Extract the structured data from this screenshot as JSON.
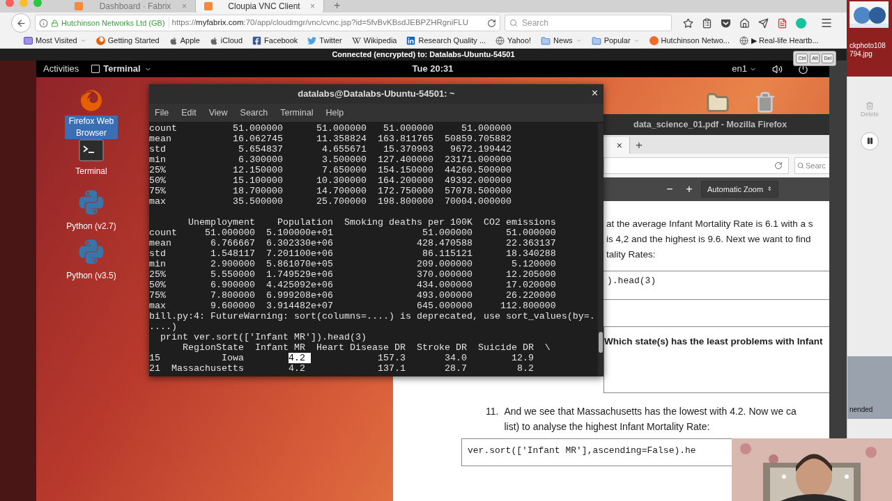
{
  "browser": {
    "tabs": [
      {
        "label": "Dashboard · Fabrix",
        "selected": false
      },
      {
        "label": "Cloupia VNC Client",
        "selected": true
      }
    ],
    "new_tab": "+",
    "tab_close": "×",
    "identity": "Hutchinson Networks Ltd (GB)",
    "url": "https://**myfabrix.com**:70/app/cloudmgr/vnc/cvnc.jsp?id=5fvBvKBsdJEBPZHRgniFLU",
    "search_placeholder": "Search",
    "bookmarks": [
      {
        "label": "Most Visited",
        "kind": "menu"
      },
      {
        "label": "Getting Started",
        "kind": "firefox"
      },
      {
        "label": "Apple",
        "kind": "apple"
      },
      {
        "label": "iCloud",
        "kind": "apple"
      },
      {
        "label": "Facebook",
        "kind": "facebook"
      },
      {
        "label": "Twitter",
        "kind": "twitter"
      },
      {
        "label": "Wikipedia",
        "kind": "wikipedia"
      },
      {
        "label": "Research Quality ...",
        "kind": "linkedin"
      },
      {
        "label": "Yahoo!",
        "kind": "globe"
      },
      {
        "label": "News",
        "kind": "folder"
      },
      {
        "label": "Popular",
        "kind": "folder"
      },
      {
        "label": "Hutchinson Netwo...",
        "kind": "hutchinson"
      },
      {
        "label": "▶ Real-life Heartb...",
        "kind": "globe"
      }
    ]
  },
  "vnc": {
    "status": "Connected (encrypted) to: Datalabs-Ubuntu-54501",
    "keys": [
      "Ctrl",
      "Alt",
      "Del"
    ]
  },
  "ubuntu": {
    "activities": "Activities",
    "app_menu": "Terminal",
    "clock": "Tue 20:31",
    "input": "en1",
    "desktop_icons": [
      {
        "label": "Firefox Web Browser",
        "kind": "firefox",
        "selected": true
      },
      {
        "label": "Terminal",
        "kind": "terminal",
        "selected": false
      },
      {
        "label": "Python (v2.7)",
        "kind": "python",
        "selected": false
      },
      {
        "label": "Python (v3.5)",
        "kind": "python",
        "selected": false
      }
    ]
  },
  "terminal": {
    "title": "datalabs@Datalabs-Ubuntu-54501: ~",
    "close": "×",
    "menu": [
      "File",
      "Edit",
      "View",
      "Search",
      "Terminal",
      "Help"
    ],
    "lines": [
      {
        "kind": "text",
        "text": "count          51.000000      51.000000   51.000000     51.000000"
      },
      {
        "kind": "text",
        "text": "mean           16.062745      11.358824  163.811765  50859.705882"
      },
      {
        "kind": "text",
        "text": "std             5.654837       4.655671   15.370903   9672.199442"
      },
      {
        "kind": "text",
        "text": "min             6.300000       3.500000  127.400000  23171.000000"
      },
      {
        "kind": "text",
        "text": "25%            12.150000       7.650000  154.150000  44260.500000"
      },
      {
        "kind": "text",
        "text": "50%            15.100000      10.300000  164.200000  49392.000000"
      },
      {
        "kind": "text",
        "text": "75%            18.700000      14.700000  172.750000  57078.500000"
      },
      {
        "kind": "text",
        "text": "max            35.500000      25.700000  198.800000  70004.000000"
      },
      {
        "kind": "blank"
      },
      {
        "kind": "text",
        "text": "       Unemployment    Population  Smoking deaths per 100K  CO2 emissions"
      },
      {
        "kind": "text",
        "text": "count     51.000000  5.100000e+01                51.000000      51.000000"
      },
      {
        "kind": "text",
        "text": "mean       6.766667  6.302330e+06               428.470588      22.363137"
      },
      {
        "kind": "text",
        "text": "std        1.548117  7.201100e+06                86.115121      18.340288"
      },
      {
        "kind": "text",
        "text": "min        2.900000  5.861070e+05               209.000000       5.120000"
      },
      {
        "kind": "text",
        "text": "25%        5.550000  1.749529e+06               370.000000      12.205000"
      },
      {
        "kind": "text",
        "text": "50%        6.900000  4.425092e+06               434.000000      17.020000"
      },
      {
        "kind": "text",
        "text": "75%        7.800000  6.999208e+06               493.000000      26.220000"
      },
      {
        "kind": "text",
        "text": "max        9.600000  3.914482e+07               645.000000     112.800000"
      },
      {
        "kind": "text",
        "text": "bill.py:4: FutureWarning: sort(columns=....) is deprecated, use sort_values(by=."
      },
      {
        "kind": "text",
        "text": "....)"
      },
      {
        "kind": "text",
        "text": "  print ver.sort(['Infant MR']).head(3)"
      },
      {
        "kind": "text",
        "text": "      RegionState  Infant MR  Heart Disease DR  Stroke DR  Suicide DR  \\"
      },
      {
        "kind": "highlight",
        "before": "15           Iowa        ",
        "highlight": "4.2 ",
        "after": "            157.3       34.0        12.9"
      },
      {
        "kind": "text",
        "text": "21  Massachusetts        4.2             137.1       28.7         8.2"
      }
    ]
  },
  "pdf_window": {
    "title": "data_science_01.pdf - Mozilla Firefox",
    "tab_close": "×",
    "new_tab": "+",
    "search_placeholder": "Searc",
    "zoom_out": "−",
    "zoom_in": "+",
    "zoom": "Automatic Zoom",
    "zoom_caret": "⇕",
    "paragraph_lines": [
      "at the average Infant Mortality Rate is 6.1 with a s",
      "is 4,2 and the highest is 9.6. Next we want to find",
      "tality Rates:"
    ],
    "code_1": ").head(3)",
    "question": "Which state(s) has the least problems with Infant",
    "item_number": "11.",
    "item_lines": [
      "And we see that Massachusetts has the lowest with 4.2. Now we ca",
      "list) to analyse the highest Infant Mortality Rate:"
    ],
    "code_2": "ver.sort(['Infant MR'],ascending=False).he"
  },
  "mac": {
    "file_labels": [
      "ckphoto108",
      "794.jpg"
    ],
    "delete": "Delete",
    "notice": "nended"
  }
}
